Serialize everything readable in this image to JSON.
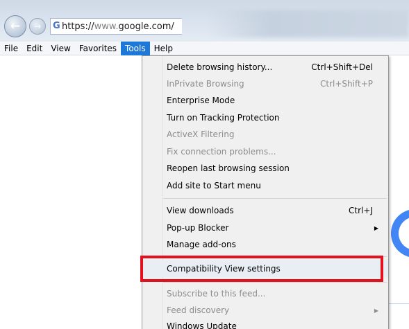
{
  "navigation": {
    "back_icon": "back-arrow-icon",
    "forward_icon": "forward-arrow-icon",
    "site_icon": "google-g-icon",
    "site_icon_glyph": "G",
    "url_prefix": "https://",
    "url_dim_part": "www.",
    "url_main_part": "google.com/"
  },
  "menubar": {
    "items": [
      {
        "label": "File"
      },
      {
        "label": "Edit"
      },
      {
        "label": "View"
      },
      {
        "label": "Favorites"
      },
      {
        "label": "Tools",
        "active": true
      },
      {
        "label": "Help"
      }
    ]
  },
  "tools_menu": {
    "items": [
      {
        "label": "Delete browsing history...",
        "shortcut": "Ctrl+Shift+Del",
        "disabled": false
      },
      {
        "label": "InPrivate Browsing",
        "shortcut": "Ctrl+Shift+P",
        "disabled": true
      },
      {
        "label": "Enterprise Mode",
        "disabled": false
      },
      {
        "label": "Turn on Tracking Protection",
        "disabled": false
      },
      {
        "label": "ActiveX Filtering",
        "disabled": true
      },
      {
        "label": "Fix connection problems...",
        "disabled": true
      },
      {
        "label": "Reopen last browsing session",
        "disabled": false
      },
      {
        "label": "Add site to Start menu",
        "disabled": false
      },
      {
        "label": "View downloads",
        "shortcut": "Ctrl+J",
        "disabled": false
      },
      {
        "label": "Pop-up Blocker",
        "submenu": true,
        "disabled": false
      },
      {
        "label": "Manage add-ons",
        "disabled": false
      },
      {
        "label": "Compatibility View settings",
        "disabled": false,
        "highlighted": true
      },
      {
        "label": "Subscribe to this feed...",
        "disabled": true
      },
      {
        "label": "Feed discovery",
        "submenu": true,
        "disabled": true
      },
      {
        "label": "Windows Update",
        "disabled": false
      }
    ]
  },
  "colors": {
    "menu_active_bg": "#1e78d7",
    "highlight_border": "#e3101e",
    "disabled_text": "#8c8c8c"
  }
}
